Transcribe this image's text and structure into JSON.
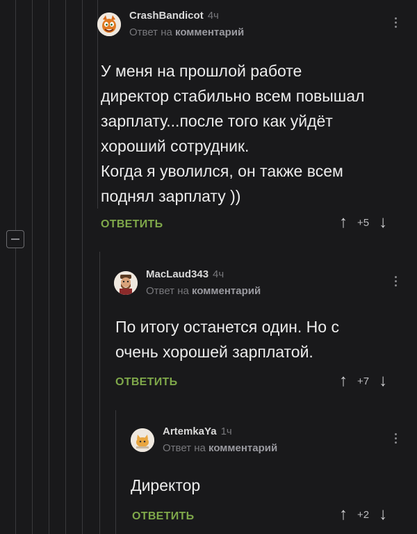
{
  "comments": [
    {
      "username": "CrashBandicot",
      "time": "4ч",
      "reply_prefix": "Ответ на",
      "reply_target": "комментарий",
      "text": "У меня на прошлой работе\nдиректор стабильно всем повышал\nзарплату...после того как уйдёт\nхороший сотрудник.\nКогда я уволился, он также всем\nподнял зарплату ))",
      "reply_button": "ОТВЕТИТЬ",
      "score": "+5",
      "avatar_icon": "crash-bandicoot-avatar"
    },
    {
      "username": "MacLaud343",
      "time": "4ч",
      "reply_prefix": "Ответ на",
      "reply_target": "комментарий",
      "text": "По итогу останется один. Но с\nочень хорошей зарплатой.",
      "reply_button": "ОТВЕТИТЬ",
      "score": "+7",
      "avatar_icon": "bearded-man-avatar"
    },
    {
      "username": "ArtemkaYa",
      "time": "1ч",
      "reply_prefix": "Ответ на",
      "reply_target": "комментарий",
      "text": "Директор",
      "reply_button": "ОТВЕТИТЬ",
      "score": "+2",
      "avatar_icon": "cat-avatar"
    }
  ],
  "colors": {
    "background": "#19191b",
    "accent": "#7fa84a",
    "thread_line": "#3a3a3d"
  }
}
